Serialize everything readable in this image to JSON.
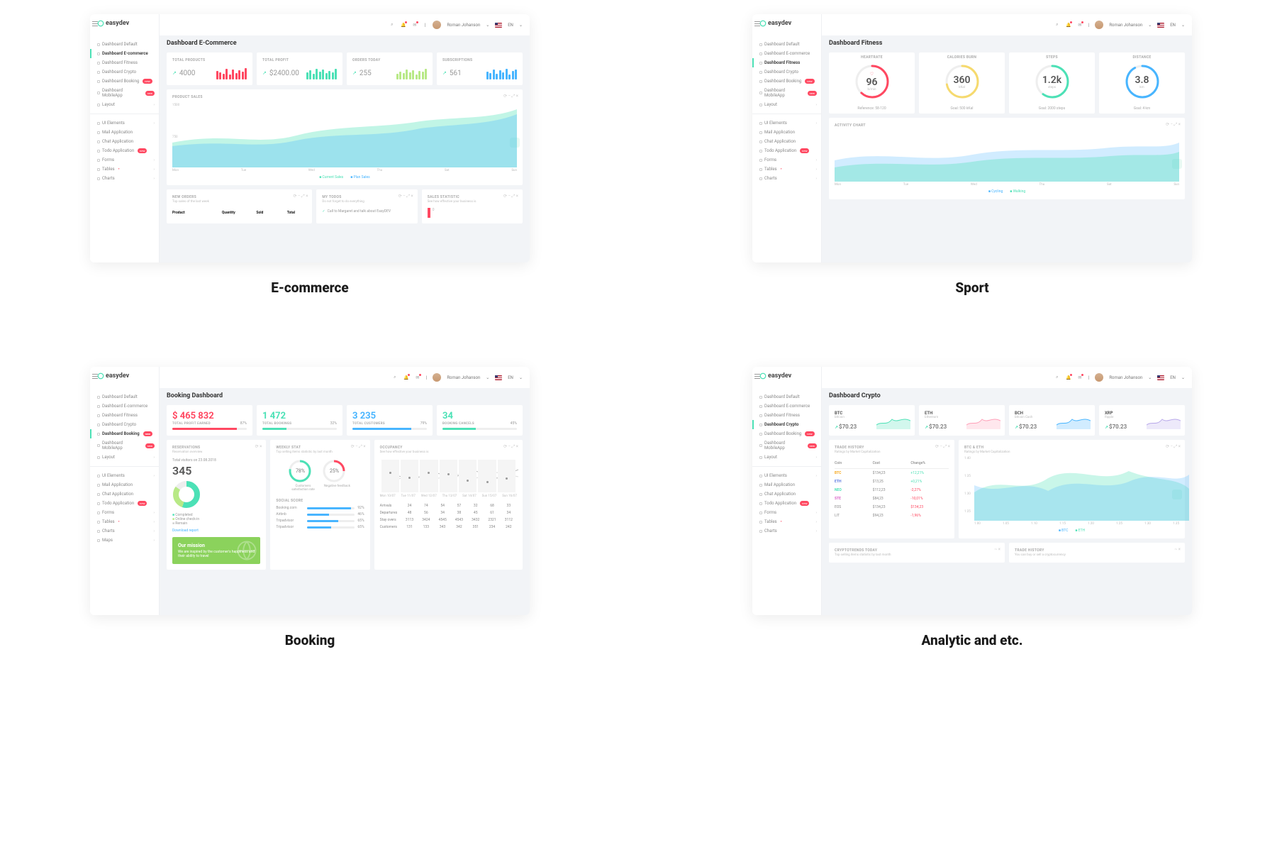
{
  "brand": "easydev",
  "user": "Roman Johanson",
  "lang": "EN",
  "sidebar_dash": [
    {
      "label": "Dashboard Default"
    },
    {
      "label": "Dashboard E-commerce"
    },
    {
      "label": "Dashboard Fitness"
    },
    {
      "label": "Dashboard Crypto"
    },
    {
      "label": "Dashboard Booking",
      "badge": "new"
    },
    {
      "label": "Dashboard MobileApp",
      "badge": "new"
    },
    {
      "label": "Layout",
      "expand": true
    }
  ],
  "sidebar_app": [
    {
      "label": "UI Elements",
      "expand": true
    },
    {
      "label": "Mail Application"
    },
    {
      "label": "Chat Application"
    },
    {
      "label": "Todo Application",
      "badge": "new"
    },
    {
      "label": "Forms",
      "expand": true
    },
    {
      "label": "Tables",
      "dot": true,
      "expand": true
    },
    {
      "label": "Charts",
      "expand": true
    }
  ],
  "sidebar_app_maps": {
    "label": "Maps",
    "expand": true
  },
  "captions": [
    "E-commerce",
    "Sport",
    "Booking",
    "Analytic and etc."
  ],
  "ecom": {
    "title": "Dashboard E-Commerce",
    "stats": [
      {
        "label": "TOTAL PRODUCTS",
        "value": "4000",
        "color": "#ff4861"
      },
      {
        "label": "TOTAL PROFIT",
        "value": "$2400.00",
        "color": "#4ce1b6"
      },
      {
        "label": "ORDERS TODAY",
        "value": "255",
        "color": "#b8e986"
      },
      {
        "label": "SUBSCRIPTIONS",
        "value": "561",
        "color": "#48b5ff"
      }
    ],
    "chart_title": "PRODUCT SALES",
    "chart_axis": [
      "Mon",
      "Tue",
      "Wed",
      "Thu",
      "Sat",
      "Sun"
    ],
    "chart_legend": [
      "Current Sales",
      "Plan Sales"
    ],
    "new_orders": {
      "title": "NEW ORDERS",
      "sub": "Top sales of the last week",
      "cols": [
        "Product",
        "Quantity",
        "Sold",
        "Total"
      ]
    },
    "todos": {
      "title": "MY TODOS",
      "sub": "Do not forget to do everything",
      "item": "Call to Margaret and talk about EasyDEV"
    },
    "sales_stat": {
      "title": "SALES STATISTIC",
      "sub": "See how effective your business is"
    }
  },
  "sport": {
    "title": "Dashboard Fitness",
    "rings": [
      {
        "label": "HEARTRATE",
        "value": "96",
        "unit": "b/min",
        "goal": "Reference: 58-120",
        "color": "#ff4861",
        "icon": "♡",
        "pct": 0.62
      },
      {
        "label": "CALORIES BURN",
        "value": "360",
        "unit": "kKal",
        "goal": "Goal: 500 kKal",
        "color": "#f6da6e",
        "icon": "",
        "pct": 0.72
      },
      {
        "label": "STEPS",
        "value": "1.2k",
        "unit": "steps",
        "goal": "Goal: 2000 steps",
        "color": "#4ce1b6",
        "icon": "",
        "pct": 0.6
      },
      {
        "label": "DISTANCE",
        "value": "3.8",
        "unit": "km",
        "goal": "Goal: 4 km",
        "color": "#48b5ff",
        "icon": "",
        "pct": 0.92
      }
    ],
    "activity": "ACTIVITY CHART",
    "act_axis": [
      "Mon",
      "Tue",
      "Wed",
      "Thu",
      "Sat",
      "Sun"
    ],
    "act_legend": [
      "Cycling",
      "Walking"
    ]
  },
  "booking": {
    "title": "Booking Dashboard",
    "stats": [
      {
        "value": "$ 465 832",
        "label": "TOTAL PROFIT EARNED",
        "pct": "87%",
        "color": "#ff4861"
      },
      {
        "value": "1 472",
        "label": "TOTAL BOOKINGS",
        "pct": "32%",
        "color": "#4ce1b6"
      },
      {
        "value": "3 235",
        "label": "TOTAL CUSTOMERS",
        "pct": "79%",
        "color": "#48b5ff"
      },
      {
        "value": "34",
        "label": "BOOKING CANCELS",
        "pct": "45%",
        "color": "#4ce1b6"
      }
    ],
    "res": {
      "title": "RESERVATIONS",
      "sub": "Reservation overview",
      "date": "Total visitors on 23.08.2018",
      "value": "345",
      "legend": [
        "Completed",
        "Online check-in",
        "Remain"
      ],
      "link": "Download report"
    },
    "weekly": {
      "title": "WEEKLY STAT",
      "sub": "Top selling items statistic by last month",
      "rings": [
        {
          "v": "78%",
          "c": "#4ce1b6",
          "l": "Customers satisfaction rate"
        },
        {
          "v": "25%",
          "c": "#ff4861",
          "l": "Negative feedback"
        }
      ],
      "score_title": "SOCIAL SCORE",
      "scores": [
        {
          "n": "Booking.com",
          "v": "92%",
          "p": 92
        },
        {
          "n": "Airbnb",
          "v": "46%",
          "p": 46
        },
        {
          "n": "Tripadvisor",
          "v": "65%",
          "p": 65
        },
        {
          "n": "Tripadvisor",
          "v": "65%",
          "p": 50
        }
      ]
    },
    "occ": {
      "title": "OCCUPANCY",
      "sub": "See how effective your business is",
      "days": [
        "Mon 10/07",
        "Tue 11/07",
        "Wed 12/07",
        "Thu 13/07",
        "Sat 14/07",
        "Sun 15/07",
        "Sun 16/07"
      ],
      "rows": [
        {
          "n": "Arrivals",
          "v": [
            "24",
            "74",
            "54",
            "57",
            "32",
            "68",
            "33"
          ]
        },
        {
          "n": "Departures",
          "v": [
            "48",
            "56",
            "34",
            "38",
            "45",
            "61",
            "34"
          ]
        },
        {
          "n": "Stay overs",
          "v": [
            "3113",
            "3424",
            "4545",
            "4543",
            "3432",
            "2321",
            "3112"
          ]
        },
        {
          "n": "Customers",
          "v": [
            "131",
            "133",
            "343",
            "342",
            "351",
            "234",
            "242"
          ]
        }
      ]
    },
    "mission": {
      "title": "Our mission",
      "text": "We are inspired by the customer's happiness and their ability to travel"
    }
  },
  "crypto": {
    "title": "Dashboard Crypto",
    "coins": [
      {
        "sym": "BTC",
        "name": "Bitcoin",
        "price": "$70.23",
        "c": "#4ce1b6"
      },
      {
        "sym": "ETH",
        "name": "Ethereum",
        "price": "$70.23",
        "c": "#ff9fb8"
      },
      {
        "sym": "BCH",
        "name": "Bitcoin Cash",
        "price": "$70.23",
        "c": "#48b5ff"
      },
      {
        "sym": "XRP",
        "name": "Ripple",
        "price": "$70.23",
        "c": "#b8a8ea"
      }
    ],
    "trade": {
      "title": "TRADE HISTORY",
      "sub": "Ratings by Market Capitalization",
      "cols": [
        "Coin",
        "Cost",
        "Change%"
      ],
      "rows": [
        {
          "c": "BTC",
          "cls": "coin-btc",
          "cost": "$134,23",
          "chg": "+12,21%",
          "pos": true
        },
        {
          "c": "ETH",
          "cls": "coin-eth",
          "cost": "$13,25",
          "chg": "+0,21%",
          "pos": true
        },
        {
          "c": "NEO",
          "cls": "coin-neo",
          "cost": "$112,23",
          "chg": "-2,27%",
          "pos": false
        },
        {
          "c": "STE",
          "cls": "coin-ste",
          "cost": "$84,23",
          "chg": "-10,01%",
          "pos": false
        },
        {
          "c": "EOS",
          "cls": "",
          "cost": "$134,23",
          "chg": "$134,23",
          "pos": false
        },
        {
          "c": "LIT",
          "cls": "",
          "cost": "$94,23",
          "chg": "-1,96%",
          "pos": false
        }
      ]
    },
    "btceth": {
      "title": "BTC & ETH",
      "sub": "Ratings by Market Capitalization",
      "y": [
        "1.40",
        "1.35",
        "1.30",
        "1.25"
      ],
      "x": [
        "1.00",
        "1.05",
        "1.10",
        "1.15",
        "1.20",
        "1.25",
        "1.30",
        "1.35"
      ],
      "legend": [
        "BTC",
        "ETH"
      ]
    },
    "trends": {
      "title": "CRYPTOTRENDS TODAY",
      "sub": "Top selling items statistic by last month"
    },
    "trade2": {
      "title": "TRADE HISTORY",
      "sub": "You can buy or sell a cryptocurrency"
    }
  },
  "chart_data": [
    {
      "type": "bar",
      "title": "TOTAL PRODUCTS mini",
      "values": [
        12,
        10,
        8,
        15,
        7,
        14,
        9,
        13,
        11,
        16
      ],
      "color": "#ff4861"
    },
    {
      "type": "bar",
      "title": "TOTAL PROFIT mini",
      "values": [
        10,
        13,
        8,
        15,
        11,
        14,
        9,
        12,
        10,
        15
      ],
      "color": "#4ce1b6"
    },
    {
      "type": "bar",
      "title": "ORDERS TODAY mini",
      "values": [
        8,
        11,
        9,
        14,
        10,
        13,
        7,
        12,
        11,
        15
      ],
      "color": "#b8e986"
    },
    {
      "type": "bar",
      "title": "SUBSCRIPTIONS mini",
      "values": [
        11,
        9,
        14,
        8,
        13,
        10,
        15,
        7,
        12,
        14
      ],
      "color": "#48b5ff"
    },
    {
      "type": "area",
      "title": "PRODUCT SALES",
      "categories": [
        "Mon",
        "Tue",
        "Wed",
        "Thu",
        "Sat",
        "Sun"
      ],
      "series": [
        {
          "name": "Current Sales",
          "values": [
            600,
            750,
            680,
            820,
            900,
            1050
          ]
        },
        {
          "name": "Plan Sales",
          "values": [
            550,
            700,
            650,
            800,
            850,
            980
          ]
        }
      ],
      "ylim": [
        0,
        1500
      ]
    },
    {
      "type": "area",
      "title": "ACTIVITY CHART",
      "categories": [
        "Mon",
        "Tue",
        "Wed",
        "Thu",
        "Sat",
        "Sun"
      ],
      "series": [
        {
          "name": "Cycling",
          "values": [
            40,
            55,
            45,
            60,
            50,
            65
          ]
        },
        {
          "name": "Walking",
          "values": [
            25,
            35,
            30,
            40,
            48,
            55
          ]
        }
      ]
    },
    {
      "type": "pie",
      "title": "RESERVATIONS",
      "series": [
        {
          "name": "Completed",
          "value": 55
        },
        {
          "name": "Online check-in",
          "value": 30
        },
        {
          "name": "Remain",
          "value": 15
        }
      ]
    },
    {
      "type": "area",
      "title": "BTC & ETH",
      "x": [
        1.0,
        1.05,
        1.1,
        1.15,
        1.2,
        1.25,
        1.3,
        1.35
      ],
      "series": [
        {
          "name": "BTC",
          "values": [
            1.26,
            1.33,
            1.29,
            1.36,
            1.31,
            1.35,
            1.3,
            1.28
          ]
        },
        {
          "name": "ETH",
          "values": [
            1.3,
            1.27,
            1.34,
            1.29,
            1.37,
            1.32,
            1.34,
            1.36
          ]
        }
      ],
      "ylim": [
        1.25,
        1.4
      ]
    }
  ]
}
